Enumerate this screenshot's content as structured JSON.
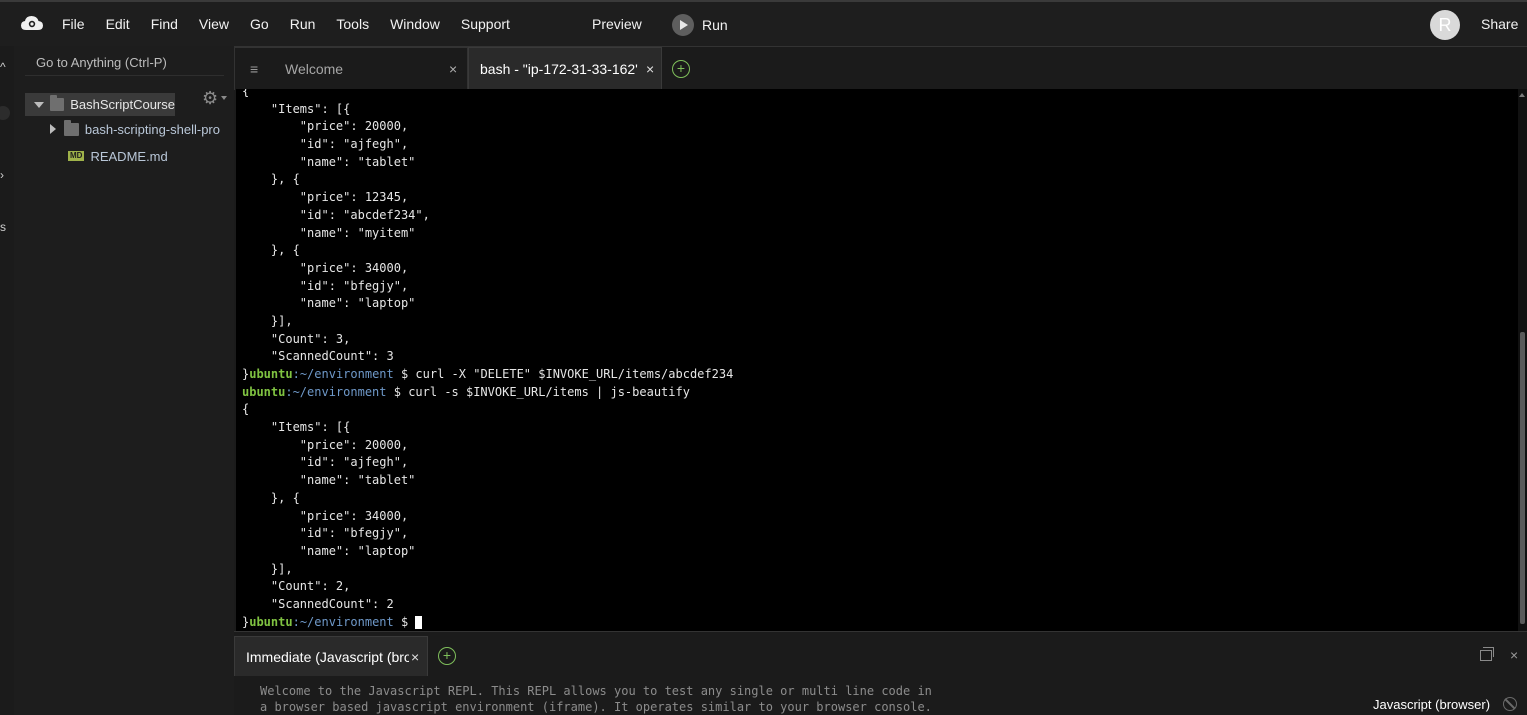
{
  "menubar": {
    "items": [
      "File",
      "Edit",
      "Find",
      "View",
      "Go",
      "Run",
      "Tools",
      "Window",
      "Support"
    ],
    "preview": "Preview",
    "run": "Run",
    "avatar_letter": "R",
    "share": "Share"
  },
  "sidebar": {
    "goto_placeholder": "Go to Anything (Ctrl-P)",
    "root_folder": "BashScriptCourse",
    "folder": "bash-scripting-shell-pro",
    "readme_badge": "MD",
    "readme": "README.md"
  },
  "left_strip": [
    "s"
  ],
  "tabs": {
    "welcome": "Welcome",
    "bash": "bash - \"ip-172-31-33-162'",
    "close_glyph": "×",
    "add_glyph": "+"
  },
  "terminal": {
    "prompt_user": "ubuntu",
    "prompt_path": ":~/environment",
    "lines": [
      {
        "t": "{"
      },
      {
        "t": "    \"Items\": [{"
      },
      {
        "t": "        \"price\": 20000,"
      },
      {
        "t": "        \"id\": \"ajfegh\","
      },
      {
        "t": "        \"name\": \"tablet\""
      },
      {
        "t": "    }, {"
      },
      {
        "t": "        \"price\": 12345,"
      },
      {
        "t": "        \"id\": \"abcdef234\","
      },
      {
        "t": "        \"name\": \"myitem\""
      },
      {
        "t": "    }, {"
      },
      {
        "t": "        \"price\": 34000,"
      },
      {
        "t": "        \"id\": \"bfegjy\","
      },
      {
        "t": "        \"name\": \"laptop\""
      },
      {
        "t": "    }],"
      },
      {
        "t": "    \"Count\": 3,"
      },
      {
        "t": "    \"ScannedCount\": 3"
      },
      {
        "pre": "}",
        "prompt": true,
        "t": " $ curl -X \"DELETE\" $INVOKE_URL/items/abcdef234"
      },
      {
        "pre": "",
        "prompt": true,
        "t": " $ curl -s $INVOKE_URL/items | js-beautify"
      },
      {
        "t": "{"
      },
      {
        "t": "    \"Items\": [{"
      },
      {
        "t": "        \"price\": 20000,"
      },
      {
        "t": "        \"id\": \"ajfegh\","
      },
      {
        "t": "        \"name\": \"tablet\""
      },
      {
        "t": "    }, {"
      },
      {
        "t": "        \"price\": 34000,"
      },
      {
        "t": "        \"id\": \"bfegjy\","
      },
      {
        "t": "        \"name\": \"laptop\""
      },
      {
        "t": "    }],"
      },
      {
        "t": "    \"Count\": 2,"
      },
      {
        "t": "    \"ScannedCount\": 2"
      },
      {
        "pre": "}",
        "prompt": true,
        "t": " $ ",
        "cursor": true
      }
    ]
  },
  "bottom_panel": {
    "tab": "Immediate (Javascript (browser))",
    "repl_line1": "Welcome to the Javascript REPL. This REPL allows you to test any single or multi line code in",
    "repl_line2": "a browser based javascript environment (iframe). It operates similar to your browser console.",
    "mode": "Javascript (browser)"
  },
  "colors": {
    "prompt_user": "#7fc241",
    "prompt_path": "#6f99c9",
    "add_button": "#7fbf5b"
  }
}
